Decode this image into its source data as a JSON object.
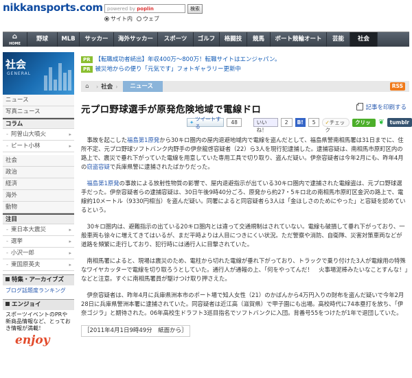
{
  "header": {
    "logo": "nikkansports.com",
    "search_powered_by": "powered by",
    "search_provider": "poplin",
    "search_button": "検索",
    "radio_site": "サイト内",
    "radio_web": "ウェブ"
  },
  "nav": {
    "home_label": "HOME",
    "items": [
      "野球",
      "MLB",
      "サッカー",
      "海外サッカー",
      "スポーツ",
      "ゴルフ",
      "格闘技",
      "競馬",
      "ボート競輪オート",
      "芸能",
      "社会"
    ],
    "active": "社会"
  },
  "sidebar": {
    "section_title": "社会",
    "section_sub": "GENERAL",
    "items": [
      "ニュース",
      "写真ニュース"
    ],
    "column_head": "コラム",
    "column_items": [
      "阿曽山大噴火",
      "ピート小林"
    ],
    "category_items": [
      "社会",
      "政治",
      "経済",
      "海外",
      "動物"
    ],
    "attention_head": "注目",
    "attention_items": [
      "東日本大震災",
      "選挙",
      "小沢一郎",
      "東国原英夫"
    ],
    "feature_head": "特集・アーカイブズ",
    "feature_link": "ブログ話題度ランキング",
    "enjoy_head": "エンジョイ",
    "enjoy_text": "スポーツイベントのPRや新商品情報など、とっておき情報が満載！",
    "enjoy_logo": "enjoy"
  },
  "pr": [
    {
      "tag": "PR",
      "text": "【転職成功者続出】年収400万～800万！転職サイトはエンジャパン。"
    },
    {
      "tag": "PR",
      "text": "被災地からの便り「元気です」フォトギャラリー更新中"
    }
  ],
  "breadcrumb": {
    "section": "社会",
    "current": "ニュース",
    "rss": "RSS"
  },
  "article": {
    "title": "元プロ野球選手が原発危険地域で電線ドロ",
    "print_label": "記事を印刷する",
    "share": {
      "tweet": "ツイートする",
      "tweet_count": "48",
      "like": "いいね！",
      "like_count": "2",
      "hatena": "B!",
      "hatena_count": "5",
      "check": "チェック",
      "clip": "クリップ",
      "tumblr": "tumblr"
    },
    "p1_pre": "事故を起こした",
    "p1_link": "福島第1原発",
    "p1_post": "から30キロ圏内の屋内退避地域内で電線を盗んだとして、福島県警南相馬署は31日までに、住所不定、元プロ野球ソフトバンク内野手の伊奈龍啓容疑者（22）ら3人を現行犯逮捕した。逮捕容疑は、南相馬市原町区内の路上で、震災で垂れ下がっていた電線を用意していた専用工具で切り取り、盗んだ疑い。伊奈容疑者は今年2月にも、昨年4月の",
    "p1_link2": "窃盗容疑",
    "p1_end": "で兵庫県警に逮捕されたばかりだった。",
    "p2_link": "福島第1原発",
    "p2_text": "の事故による放射性物質の影響で、屋内退避指示が出ている30キロ圏内で逮捕された電線盗は、元プロ野球選手だった。伊奈容疑者らの逮捕容疑は、30日午後9時40分ごろ、原発から約27・5キロ北の南相馬市原町区金沢の路上で、電線約10メートル（9330円相当）を盗んだ疑い。同署によると同容疑者ら3人は「金ほしさのためにやった」と容疑を認めているという。",
    "p3_text": "30キロ圏内は、避難指示の出ている20キロ圏内とは違って交通規制はされていない。電線も破損して垂れ下がっており、一般車両も徐々に増えてきてはいるが、まだ平時よりは人目につきにくい状況。ただ警察や消防、自衛隊、災害対策車両などが道路を頻繁に走行しており、犯行時には通行人に目撃されていた。",
    "p4_text": "南相馬署によると、現場は震災のため、電柱から切れた電線が垂れ下がっており、トラックで乗り付けた3人が電線用の特殊なワイヤカッターで電線を切り取ろうとしていた。通行人が通報の上、「何をやってんだ！　火事場泥棒みたいなことすんな！」などと注意。すぐに南相馬署員が駆けつけ取り押さえた。",
    "p5_text": "伊奈容疑者は、昨年4月に兵庫県洲本市のポート場で知人女性（21）のかばんから4万円入りの財布を盗んだ疑いで今年2月28日に兵庫県警洲本署に逮捕されていた。同容疑者は近江高（滋賀県）で甲子園にも出場。高校時代に74本塁打を放ち、「伊奈ゴジラ」と期待された。06年高校生ドラフト3巡目指名でソフトバンクに入団。背番号55をつけたが1年で退団していた。",
    "dateline": "［2011年4月1日9時49分　紙面から］"
  }
}
